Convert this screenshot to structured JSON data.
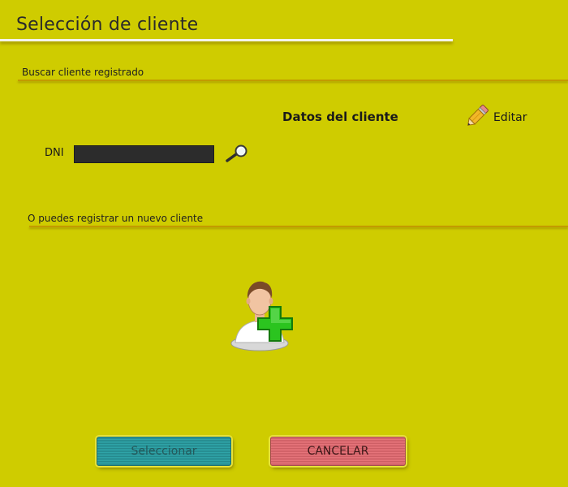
{
  "window": {
    "title": "Selección de cliente"
  },
  "search_section": {
    "heading": "Buscar cliente registrado",
    "client_data_title": "Datos del cliente",
    "edit_label": "Editar",
    "dni_label": "DNI",
    "dni_value": ""
  },
  "register_section": {
    "heading": "O puedes registrar un nuevo cliente"
  },
  "actions": {
    "select_label": "Seleccionar",
    "cancel_label": "CANCELAR"
  },
  "icons": {
    "edit": "pencil-icon",
    "search": "magnifier-icon",
    "new_client": "add-user-icon"
  },
  "colors": {
    "background": "#cfcc00",
    "select_button": "#2fa4a8",
    "cancel_button": "#e6747a"
  }
}
